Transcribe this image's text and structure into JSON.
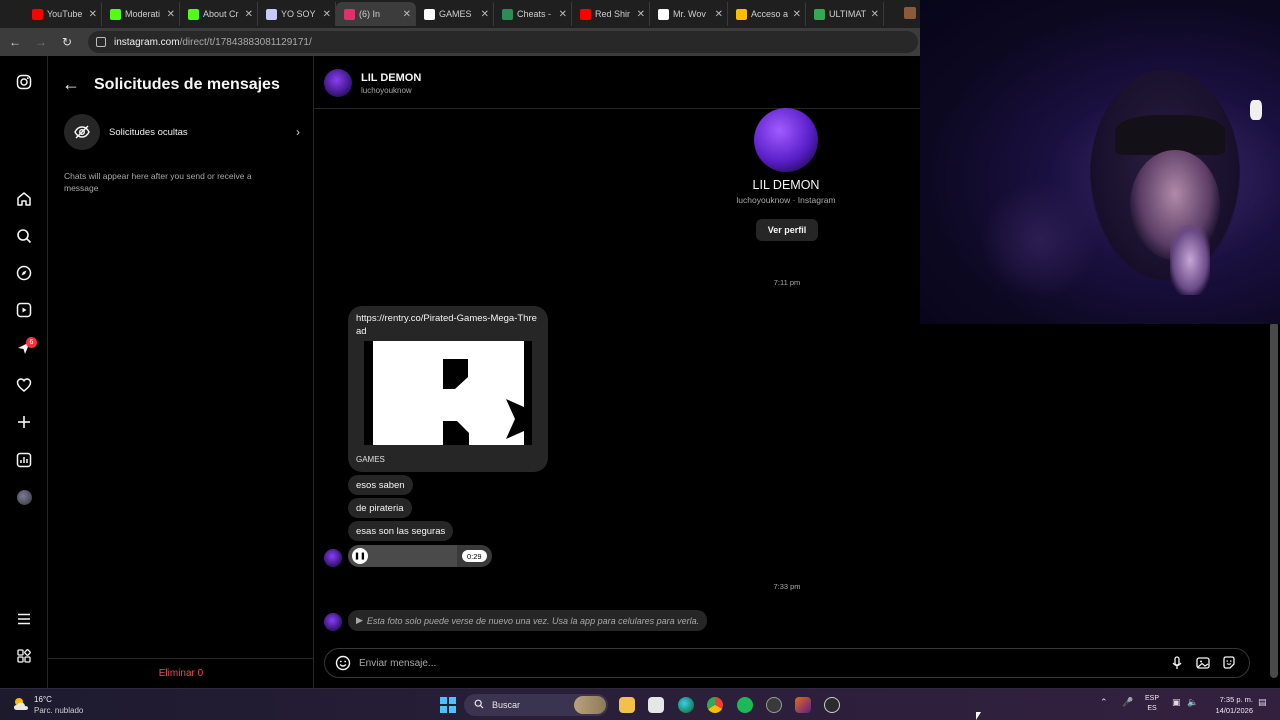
{
  "browser": {
    "tabs": [
      {
        "label": "YouTube",
        "color": "#ff0000",
        "active": false
      },
      {
        "label": "Moderati",
        "color": "#53fc18",
        "active": false
      },
      {
        "label": "About Cr",
        "color": "#53fc18",
        "active": false
      },
      {
        "label": "YO SOY",
        "color": "#c8c8ff",
        "active": false
      },
      {
        "label": "(6) In",
        "color": "#e1306c",
        "active": true
      },
      {
        "label": "GAMES",
        "color": "#ffffff",
        "active": false
      },
      {
        "label": "Cheats -",
        "color": "#2e8b57",
        "active": false
      },
      {
        "label": "Red Shir",
        "color": "#ff0000",
        "active": false
      },
      {
        "label": "Mr. Wov",
        "color": "#ffffff",
        "active": false
      },
      {
        "label": "Acceso a",
        "color": "#fbbc04",
        "active": false
      },
      {
        "label": "ULTIMAT",
        "color": "#34a853",
        "active": false
      }
    ],
    "url_domain": "instagram.com",
    "url_path": "/direct/t/17843883081129171/"
  },
  "rail": {
    "notification_count": "6"
  },
  "requests_panel": {
    "title": "Solicitudes de mensajes",
    "hidden_requests_label": "Solicitudes ocultas",
    "empty_note": "Chats will appear here after you send or receive a message",
    "delete_label": "Eliminar 0"
  },
  "chat": {
    "header_name": "LIL DEMON",
    "header_username": "luchoyouknow",
    "profile_name": "LIL DEMON",
    "profile_sub": "luchoyouknow · Instagram",
    "view_profile_button": "Ver perfil",
    "time_1": "7:11 pm",
    "link_url": "https://rentry.co/Pirated-Games-Mega-Thread",
    "link_caption": "GAMES",
    "messages": [
      "esos saben",
      "de pirateria",
      "esas son las seguras"
    ],
    "voice_duration": "0:29",
    "voice_progress": 0.76,
    "time_2": "7:33 pm",
    "view_once_text": "Esta foto solo puede verse de nuevo una vez. Usa la app para celulares para verla.",
    "composer_placeholder": "Enviar mensaje..."
  },
  "taskbar": {
    "weather_temp": "16°C",
    "weather_desc": "Parc. nublado",
    "search_label": "Buscar",
    "lang_1": "ESP",
    "lang_2": "ES",
    "time": "7:35 p. m.",
    "date": "14/01/2026"
  },
  "colors": {
    "accent_red": "#ff3040",
    "delete_red": "#ed4956",
    "bubble": "#262626"
  }
}
